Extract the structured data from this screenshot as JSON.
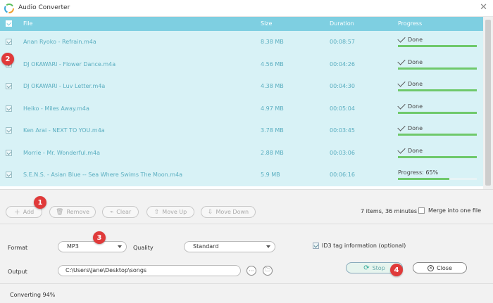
{
  "window": {
    "title": "Audio Converter"
  },
  "table": {
    "headers": {
      "file": "File",
      "size": "Size",
      "duration": "Duration",
      "progress": "Progress"
    },
    "rows": [
      {
        "file": "Anan Ryoko - Refrain.m4a",
        "size": "8.38 MB",
        "duration": "00:08:57",
        "progress_label": "Done",
        "progress": 1.0
      },
      {
        "file": "DJ OKAWARI - Flower Dance.m4a",
        "size": "4.56 MB",
        "duration": "00:04:26",
        "progress_label": "Done",
        "progress": 1.0
      },
      {
        "file": "DJ OKAWARI - Luv Letter.m4a",
        "size": "4.38 MB",
        "duration": "00:04:30",
        "progress_label": "Done",
        "progress": 1.0
      },
      {
        "file": "Heiko - Miles Away.m4a",
        "size": "4.97 MB",
        "duration": "00:05:04",
        "progress_label": "Done",
        "progress": 1.0
      },
      {
        "file": "Ken Arai - NEXT TO YOU.m4a",
        "size": "3.78 MB",
        "duration": "00:03:45",
        "progress_label": "Done",
        "progress": 1.0
      },
      {
        "file": "Morrie - Mr. Wonderful.m4a",
        "size": "2.88 MB",
        "duration": "00:03:06",
        "progress_label": "Done",
        "progress": 1.0
      },
      {
        "file": "S.E.N.S. - Asian Blue -- Sea Where Swims The Moon.m4a",
        "size": "5.9 MB",
        "duration": "00:06:16",
        "progress_label": "Progress: 65%",
        "progress": 0.65
      }
    ]
  },
  "toolbar": {
    "add": "Add",
    "remove": "Remove",
    "clear": "Clear",
    "move_up": "Move Up",
    "move_down": "Move Down",
    "items_info": "7 items, 36 minutes",
    "merge_label": "Merge into one file"
  },
  "settings": {
    "format_label": "Format",
    "format_value": "MP3",
    "quality_label": "Quality",
    "quality_value": "Standard",
    "id3_label": "ID3 tag information (optional)",
    "output_label": "Output",
    "output_path": "C:\\Users\\Jane\\Desktop\\songs",
    "stop_label": "Stop",
    "close_label": "Close"
  },
  "status": {
    "text": "Converting 94%"
  },
  "markers": [
    "1",
    "2",
    "3",
    "4"
  ],
  "colors": {
    "header": "#7ecfe1",
    "row_bg": "#d8f2f6",
    "progress_fill": "#6fc96b",
    "marker": "#e03a3a"
  }
}
